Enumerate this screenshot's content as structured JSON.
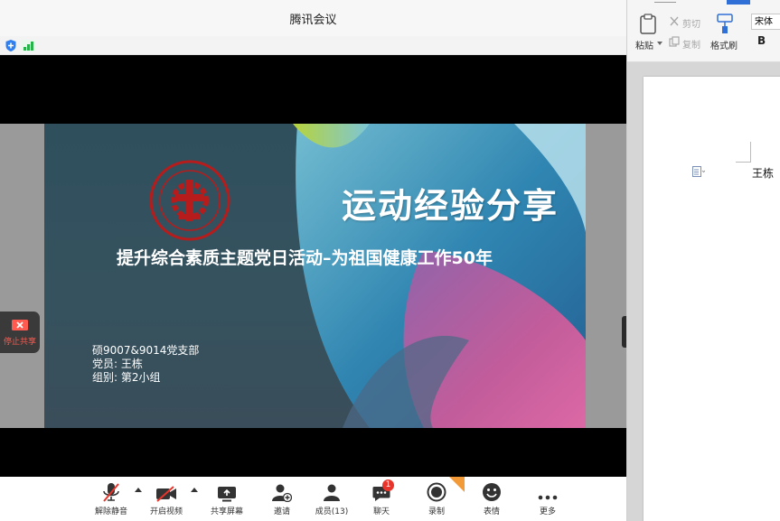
{
  "window": {
    "title": "腾讯会议"
  },
  "slide": {
    "title": "运动经验分享",
    "subtitle": "提升综合素质主题党日活动–为祖国健康工作50年",
    "info": [
      "硕9007&9014党支部",
      "党员: 王栋",
      "组别: 第2小组"
    ]
  },
  "stop_share": {
    "label": "停止共享"
  },
  "toolbar": {
    "mute": "解除静音",
    "video": "开启视频",
    "share": "共享屏幕",
    "invite": "邀请",
    "members": "成员(13)",
    "chat": "聊天",
    "chat_badge": "1",
    "record": "录制",
    "reactions": "表情",
    "more": "更多"
  },
  "editor": {
    "paste": "粘贴",
    "cut": "剪切",
    "copy": "复制",
    "format_painter": "格式刷",
    "font": "宋体",
    "bold": "B",
    "doc_text": "王栋"
  },
  "colors": {
    "accent_red": "#e8352b",
    "signal_green": "#27b24a",
    "shield_blue": "#2f7ff0",
    "stop_share_text": "#ff5a4f"
  }
}
